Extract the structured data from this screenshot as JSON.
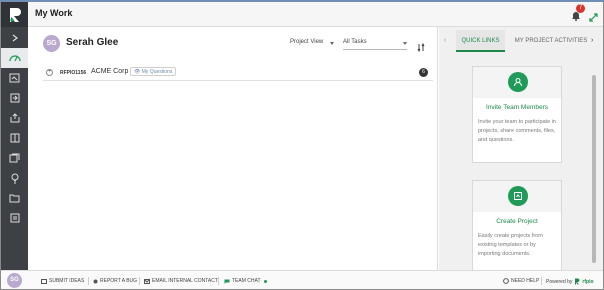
{
  "app": {
    "title": "My Work",
    "notification_count": "7"
  },
  "user": {
    "initials": "SG",
    "name": "Serah Glee"
  },
  "filters": {
    "view": "Project View",
    "tasks": "All Tasks"
  },
  "projects": [
    {
      "code": "RFPIO1156",
      "company": "ACME Corp",
      "tag": "My Questions",
      "count": "6"
    }
  ],
  "right_panel": {
    "tabs": [
      {
        "label": "QUICK LINKS"
      },
      {
        "label": "MY PROJECT ACTIVITIES"
      }
    ],
    "cards": [
      {
        "title": "Invite Team Members",
        "description": "Invite your team to participate in projects, share comments, files, and questions.",
        "icon": "user-icon"
      },
      {
        "title": "Create Project",
        "description": "Easily create projects from existing templates or by importing documents.",
        "icon": "document-icon"
      }
    ]
  },
  "footer": {
    "submit_ideas": "SUBMIT IDEAS",
    "report_bug": "REPORT A BUG",
    "email_contact": "EMAIL INTERNAL CONTACT",
    "team_chat": "TEAM CHAT",
    "need_help": "NEED HELP",
    "powered_by": "Powered by",
    "brand": "rfpio"
  },
  "colors": {
    "accent": "#1e8a4a",
    "rail": "#3d4045",
    "badge": "#d9342b"
  }
}
